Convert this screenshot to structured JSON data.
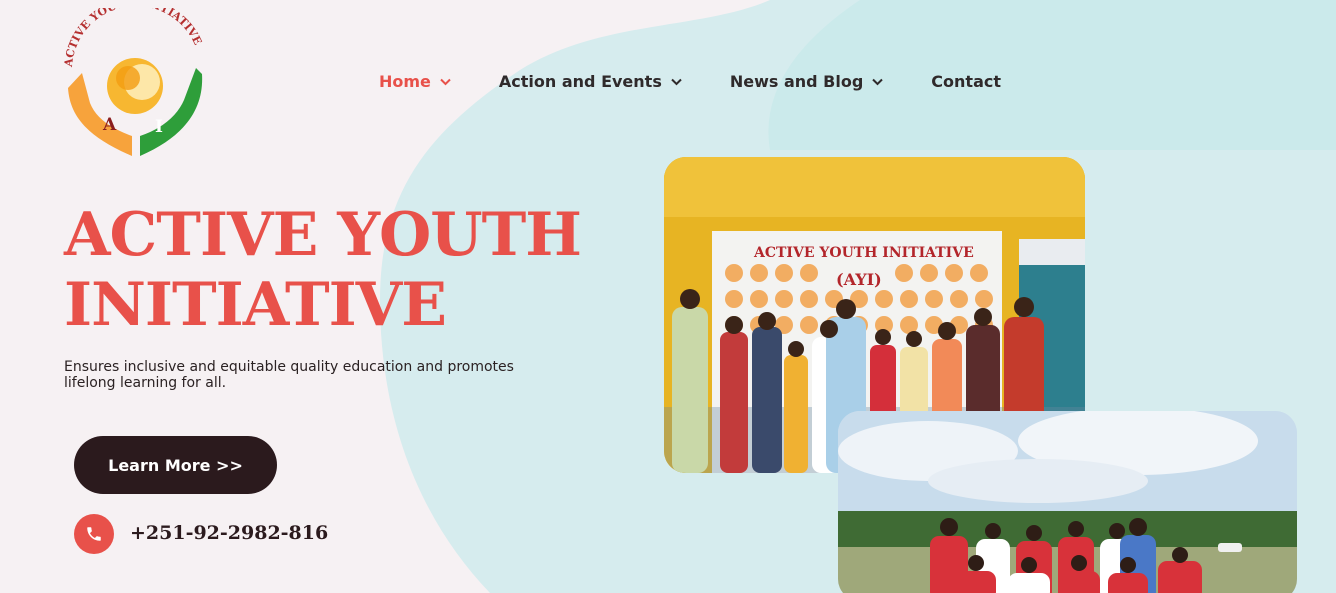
{
  "logo": {
    "arc_text": "ACTIVE YOUTH INITIATIVE",
    "letters": [
      "A",
      "I"
    ]
  },
  "nav": {
    "items": [
      {
        "label": "Home",
        "active": true,
        "has_dropdown": true
      },
      {
        "label": "Action and Events",
        "active": false,
        "has_dropdown": true
      },
      {
        "label": "News and Blog",
        "active": false,
        "has_dropdown": true
      },
      {
        "label": "Contact",
        "active": false,
        "has_dropdown": false
      }
    ]
  },
  "hero": {
    "title_line1": "ACTIVE YOUTH",
    "title_line2": "INITIATIVE",
    "subtitle": "Ensures inclusive and equitable quality education and promotes lifelong learning for all.",
    "cta_label": "Learn More >>",
    "phone": "+251-92-2982-816"
  },
  "photos": {
    "banner_title": "ACTIVE YOUTH INITIATIVE",
    "banner_sub": "(AYI)"
  },
  "colors": {
    "accent": "#e8514a",
    "dark": "#2b1a1d",
    "background": "#f6f1f3",
    "blob": "#d3ecee"
  },
  "icons": {
    "nav_dropdown": "chevron-down-icon",
    "phone": "phone-icon"
  }
}
